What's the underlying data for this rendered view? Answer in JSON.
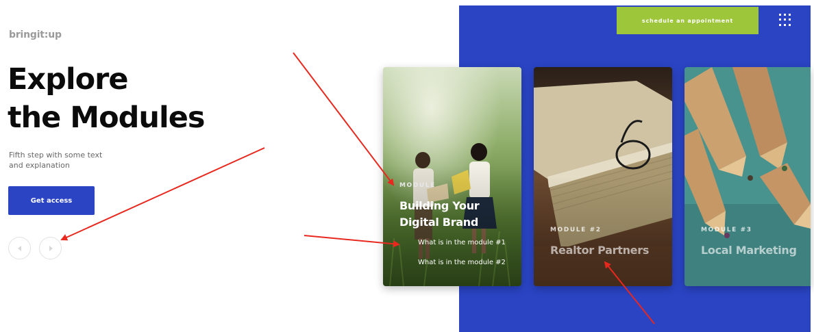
{
  "brand": {
    "logo_text": "bringit:up"
  },
  "hero": {
    "title_line1": "Explore",
    "title_line2": "the Modules",
    "description": "Fifth step with some text and explanation",
    "cta_label": "Get access"
  },
  "header": {
    "schedule_label": "schedule an appointment",
    "menu_icon": "grid-menu-icon"
  },
  "slider": {
    "prev_icon": "arrow-left-icon",
    "next_icon": "arrow-right-icon"
  },
  "modules": [
    {
      "label": "MODULE",
      "title_line1": "Building Your",
      "title_line2": "Digital Brand",
      "links": [
        "What is in the module #1",
        "What is in the module #2"
      ]
    },
    {
      "label": "MODULE #2",
      "title": "Realtor Partners"
    },
    {
      "label": "MODULE #3",
      "title": "Local Marketing"
    }
  ],
  "colors": {
    "primary_blue": "#2a44c4",
    "accent_green": "#9dc63a",
    "annotation_red": "#e8281e"
  }
}
